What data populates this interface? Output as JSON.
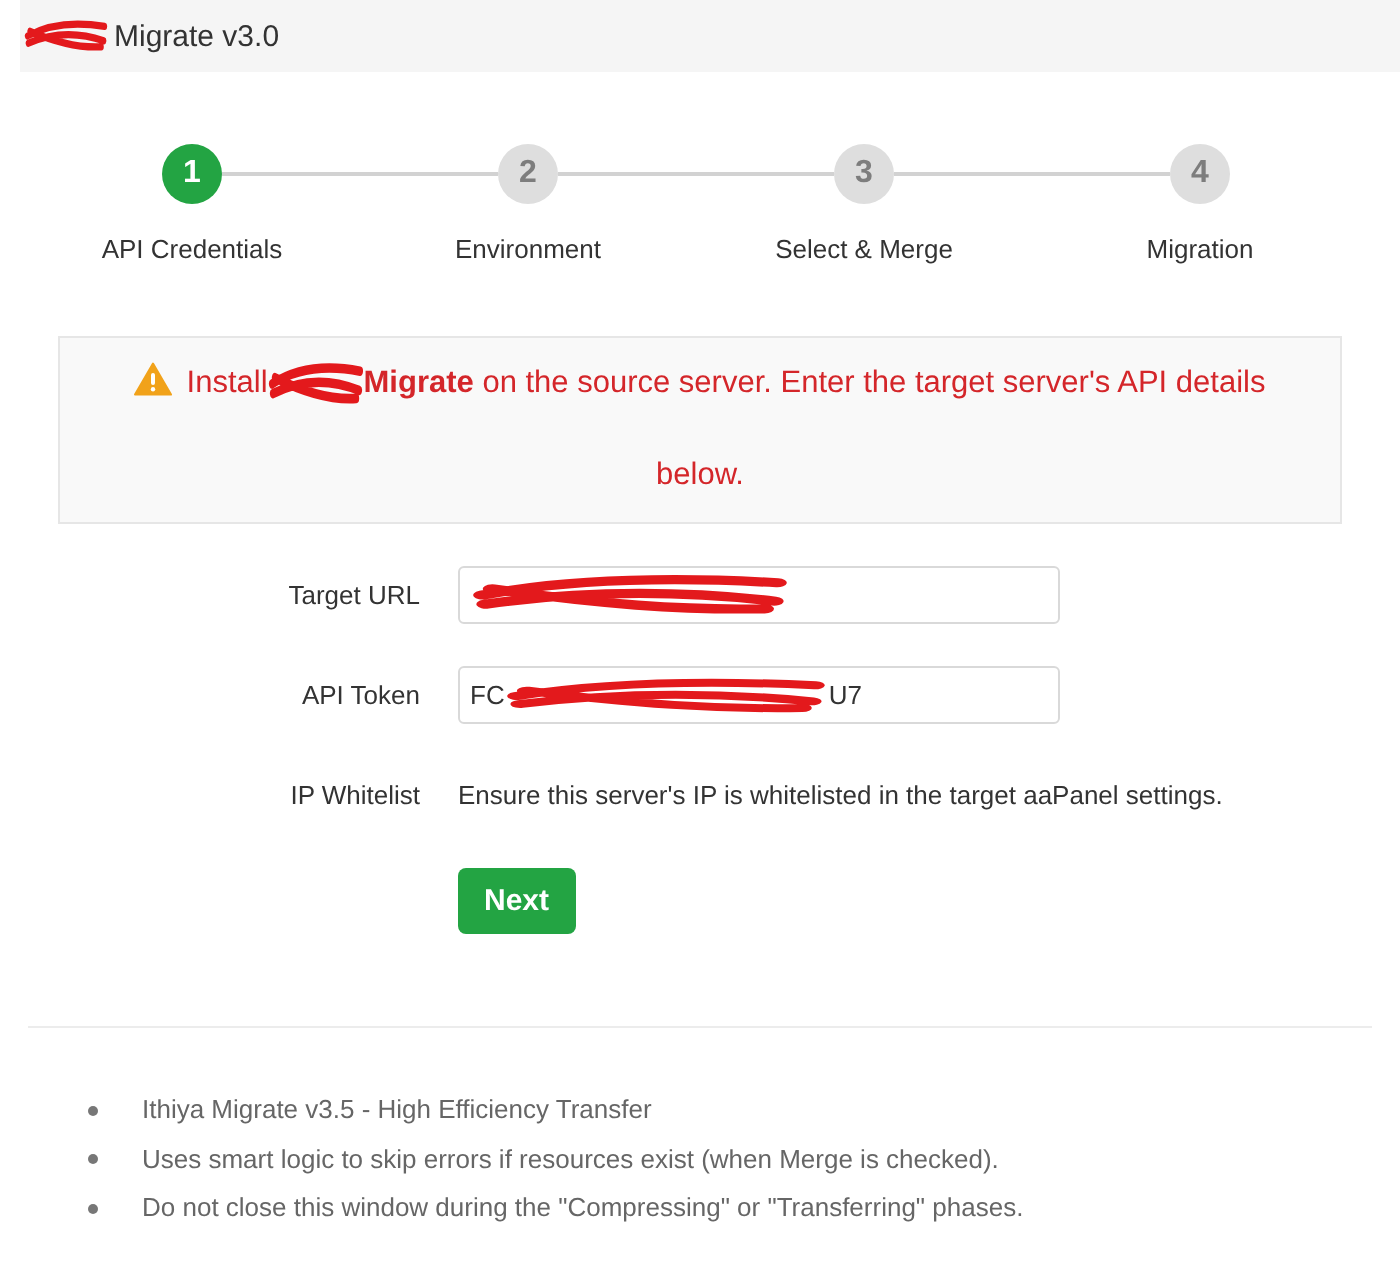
{
  "window": {
    "title": "Migrate v3.0",
    "redacted": true
  },
  "steps": [
    {
      "number": "1",
      "label": "API Credentials",
      "selected": true
    },
    {
      "number": "2",
      "label": "Environment",
      "selected": false
    },
    {
      "number": "3",
      "label": "Select & Merge",
      "selected": false
    },
    {
      "number": "4",
      "label": "Migration",
      "selected": false
    }
  ],
  "notice": {
    "text_before": "Install",
    "text_after": "**Migrate** on the source server. Enter the target server's API details below.",
    "redacted": true
  },
  "form": {
    "fields": [
      {
        "kind": "input",
        "label": "Target URL",
        "redacted": true
      },
      {
        "kind": "input",
        "label": "API Token",
        "value_start": "FC",
        "value_end": "U7",
        "redacted": true
      },
      {
        "kind": "text",
        "label": "IP Whitelist",
        "text": "Ensure this server's IP is whitelisted in the target aaPanel settings."
      }
    ],
    "button": "Next"
  },
  "notes": [
    "Ithiya Migrate v3.5 - High Efficiency Transfer",
    "Uses smart logic to skip errors if resources exist (when Merge is checked).",
    "Do not close this window during the \"Compressing\" or \"Transferring\" phases."
  ]
}
